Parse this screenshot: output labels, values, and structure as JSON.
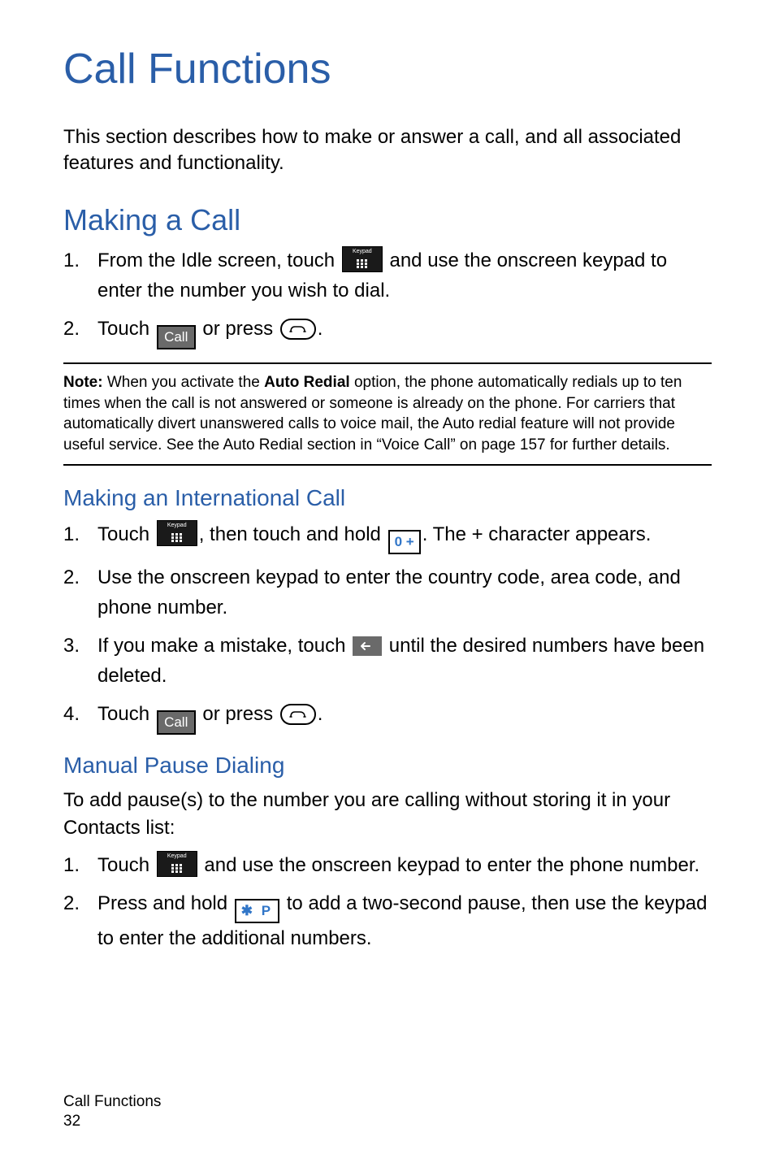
{
  "title": "Call Functions",
  "intro": "This section describes how to make or answer a call, and all associated features and functionality.",
  "section1": {
    "heading": "Making a Call",
    "step1a": "From the Idle screen, touch ",
    "step1b": " and use the onscreen keypad to enter the number you wish to dial.",
    "step2a": "Touch ",
    "step2b": " or press ",
    "step2c": ".",
    "call_label": "Call"
  },
  "note": {
    "label": "Note: ",
    "text1": "When you activate the ",
    "bold": "Auto Redial",
    "text2": " option, the phone automatically redials up to ten times when the call is not answered or someone is already on the phone. For carriers that automatically divert unanswered calls to voice mail, the Auto redial feature will not provide useful service. See the Auto Redial section in “Voice Call” on page 157 for further details."
  },
  "section2": {
    "heading": "Making an International Call",
    "s1a": "Touch ",
    "s1b": ", then touch and hold ",
    "key0": "0 +",
    "s1c": ". The + character appears.",
    "s2": "Use the onscreen keypad to enter the country code, area code, and phone number.",
    "s3a": "If you make a mistake, touch ",
    "s3b": " until the desired numbers have been deleted.",
    "s4a": "Touch ",
    "s4b": " or press ",
    "s4c": ".",
    "call_label": "Call"
  },
  "section3": {
    "heading": "Manual Pause Dialing",
    "intro": "To add pause(s) to the number you are calling without storing it in your Contacts list:",
    "s1a": "Touch ",
    "s1b": " and use the onscreen keypad to enter the phone number.",
    "s2a": "Press and hold ",
    "keyStar": "✱ P",
    "s2b": " to add a two-second pause, then use the keypad to enter the additional numbers."
  },
  "footer": {
    "label": "Call Functions",
    "page": "32"
  }
}
